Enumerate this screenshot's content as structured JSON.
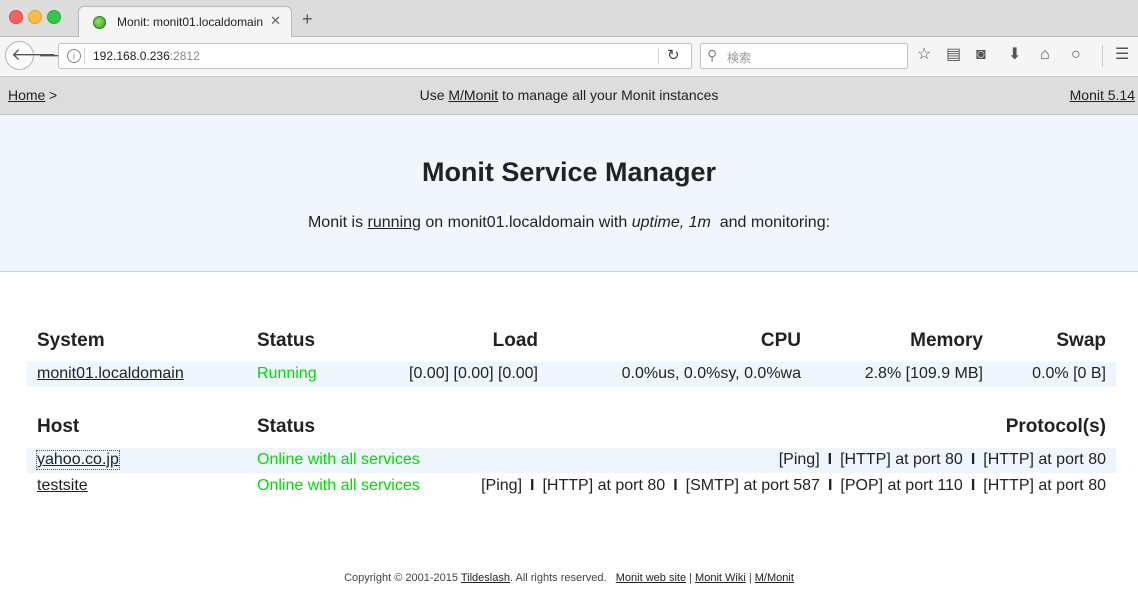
{
  "browser": {
    "tab_title": "Monit: monit01.localdomain",
    "tab_close": "✕",
    "new_tab": "+",
    "url_host": "192.168.0.236",
    "url_port": ":2812",
    "search_placeholder": "検索"
  },
  "nav": {
    "home_label": "Home",
    "home_arrow": ">",
    "msg_prefix": "Use ",
    "msg_link": "M/Monit",
    "msg_suffix": " to manage all your Monit instances",
    "version_label": "Monit 5.14"
  },
  "header": {
    "title": "Monit Service Manager",
    "status_prefix": "Monit is ",
    "status_state": "running",
    "status_mid": " on monit01.localdomain with ",
    "status_uptime": "uptime, 1m",
    "status_suffix": " and monitoring:"
  },
  "system_table": {
    "headers": [
      "System",
      "Status",
      "Load",
      "CPU",
      "Memory",
      "Swap"
    ],
    "rows": [
      {
        "name": "monit01.localdomain",
        "status": "Running",
        "load": "[0.00] [0.00] [0.00]",
        "cpu": "0.0%us, 0.0%sy, 0.0%wa",
        "memory": "2.8% [109.9 MB]",
        "swap": "0.0% [0 B]"
      }
    ]
  },
  "host_table": {
    "headers": [
      "Host",
      "Status",
      "Protocol(s)"
    ],
    "rows": [
      {
        "name": "yahoo.co.jp",
        "status": "Online with all services",
        "protocols": [
          "[Ping]",
          "[HTTP] at port 80",
          "[HTTP] at port 80"
        ]
      },
      {
        "name": "testsite",
        "status": "Online with all services",
        "protocols": [
          "[Ping]",
          "[HTTP] at port 80",
          "[SMTP] at port 587",
          "[POP] at port 110",
          "[HTTP] at port 80"
        ]
      }
    ],
    "separator": "I"
  },
  "footer": {
    "copyright": "Copyright © 2001-2015 ",
    "company": "Tildeslash",
    "rights": ". All rights reserved.",
    "link1": "Monit web site",
    "link2": "Monit Wiki",
    "link3": "M/Monit",
    "sep": "|"
  }
}
